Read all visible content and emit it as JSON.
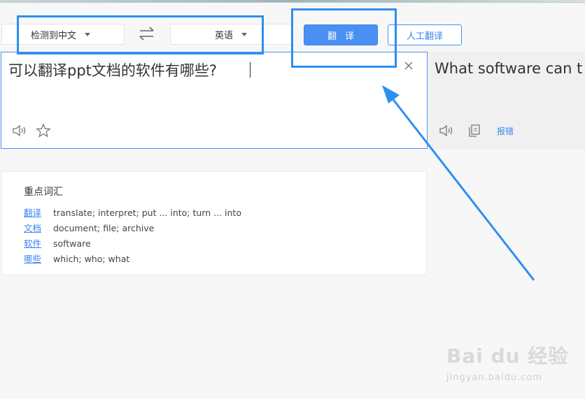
{
  "languages": {
    "source": "检测到中文",
    "target": "英语"
  },
  "buttons": {
    "translate": "翻译",
    "human_translate": "人工翻译"
  },
  "input": {
    "text": "可以翻译ppt文档的软件有哪些?"
  },
  "output": {
    "text": "What software can t",
    "report": "报错"
  },
  "vocab": {
    "title": "重点词汇",
    "items": [
      {
        "word": "翻译",
        "def": "translate; interpret; put ... into; turn ... into"
      },
      {
        "word": "文档",
        "def": "document; file; archive"
      },
      {
        "word": "软件",
        "def": "software"
      },
      {
        "word": "哪些",
        "def": "which; who; what"
      }
    ]
  },
  "watermark": {
    "logo": "Bai du 经验",
    "sub": "jingyan.baidu.com"
  },
  "colors": {
    "accent": "#4a90f2",
    "annotation": "#2d8ff0"
  },
  "icons": [
    "swap-icon",
    "close-icon",
    "speaker-icon",
    "star-icon",
    "copy-icon"
  ]
}
